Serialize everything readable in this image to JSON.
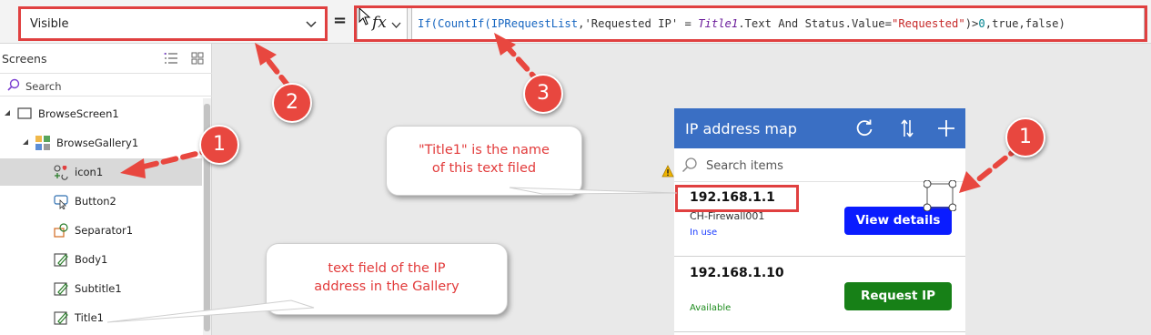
{
  "formula_bar": {
    "property_value": "Visible",
    "equals": "=",
    "fx_label": "fx",
    "formula": [
      {
        "t": "If(",
        "c": "fn"
      },
      {
        "t": "CountIf(",
        "c": "fn"
      },
      {
        "t": "IPRequestList",
        "c": "fn"
      },
      {
        "t": ",'Requested IP' = ",
        "c": "pl"
      },
      {
        "t": "Title1",
        "c": "it"
      },
      {
        "t": ".Text And Status.Value=",
        "c": "pl"
      },
      {
        "t": "\"Requested\"",
        "c": "str"
      },
      {
        "t": ")>",
        "c": "pl"
      },
      {
        "t": "0",
        "c": "num"
      },
      {
        "t": ",true,false)",
        "c": "pl"
      }
    ]
  },
  "tree": {
    "title": "Screens",
    "search_placeholder": "Search",
    "nodes": [
      {
        "label": "BrowseScreen1",
        "icon": "screen-icon",
        "depth": 0,
        "expanded": true,
        "selected": false
      },
      {
        "label": "BrowseGallery1",
        "icon": "gallery-icon",
        "depth": 1,
        "expanded": true,
        "selected": false
      },
      {
        "label": "icon1",
        "icon": "icon-control-icon",
        "depth": 2,
        "expanded": false,
        "selected": true
      },
      {
        "label": "Button2",
        "icon": "button-control-icon",
        "depth": 2,
        "expanded": false,
        "selected": false
      },
      {
        "label": "Separator1",
        "icon": "separator-control-icon",
        "depth": 2,
        "expanded": false,
        "selected": false
      },
      {
        "label": "Body1",
        "icon": "label-edit-icon",
        "depth": 2,
        "expanded": false,
        "selected": false
      },
      {
        "label": "Subtitle1",
        "icon": "label-edit-icon",
        "depth": 2,
        "expanded": false,
        "selected": false
      },
      {
        "label": "Title1",
        "icon": "label-edit-icon",
        "depth": 2,
        "expanded": false,
        "selected": false
      }
    ]
  },
  "app": {
    "title": "IP address map",
    "search_placeholder": "Search items",
    "header_color": "#3a6fc4",
    "items": [
      {
        "title": "192.168.1.1",
        "subtitle": "CH-Firewall001",
        "status": "In use",
        "status_color": "#1a3cff",
        "button": "View details",
        "button_color": "#0a1cff"
      },
      {
        "title": "192.168.1.10",
        "subtitle": "",
        "status": "Available",
        "status_color": "#1e8c1e",
        "button": "Request IP",
        "button_color": "#178017"
      }
    ]
  },
  "annotations": {
    "callout_title1": [
      "\"Title1\" is the name",
      "of this text filed"
    ],
    "callout_textfield": [
      "text field of the IP",
      "address in the Gallery"
    ],
    "badges": [
      "1",
      "2",
      "3",
      "1"
    ],
    "accent_color": "#e04040"
  }
}
